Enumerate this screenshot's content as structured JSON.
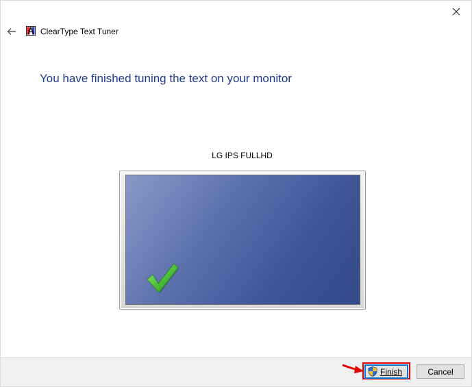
{
  "window": {
    "title": "ClearType Text Tuner"
  },
  "page": {
    "heading": "You have finished tuning the text on your monitor",
    "monitor_name": "LG IPS FULLHD"
  },
  "footer": {
    "finish_label": "Finish",
    "cancel_label": "Cancel"
  },
  "colors": {
    "heading": "#1e3a8c",
    "highlight": "#e60000",
    "check": "#3fae2a"
  },
  "icons": {
    "close": "close-icon",
    "back": "back-arrow-icon",
    "app": "cleartype-app-icon",
    "check": "checkmark-icon",
    "shield": "uac-shield-icon",
    "annotation": "red-arrow-icon"
  }
}
